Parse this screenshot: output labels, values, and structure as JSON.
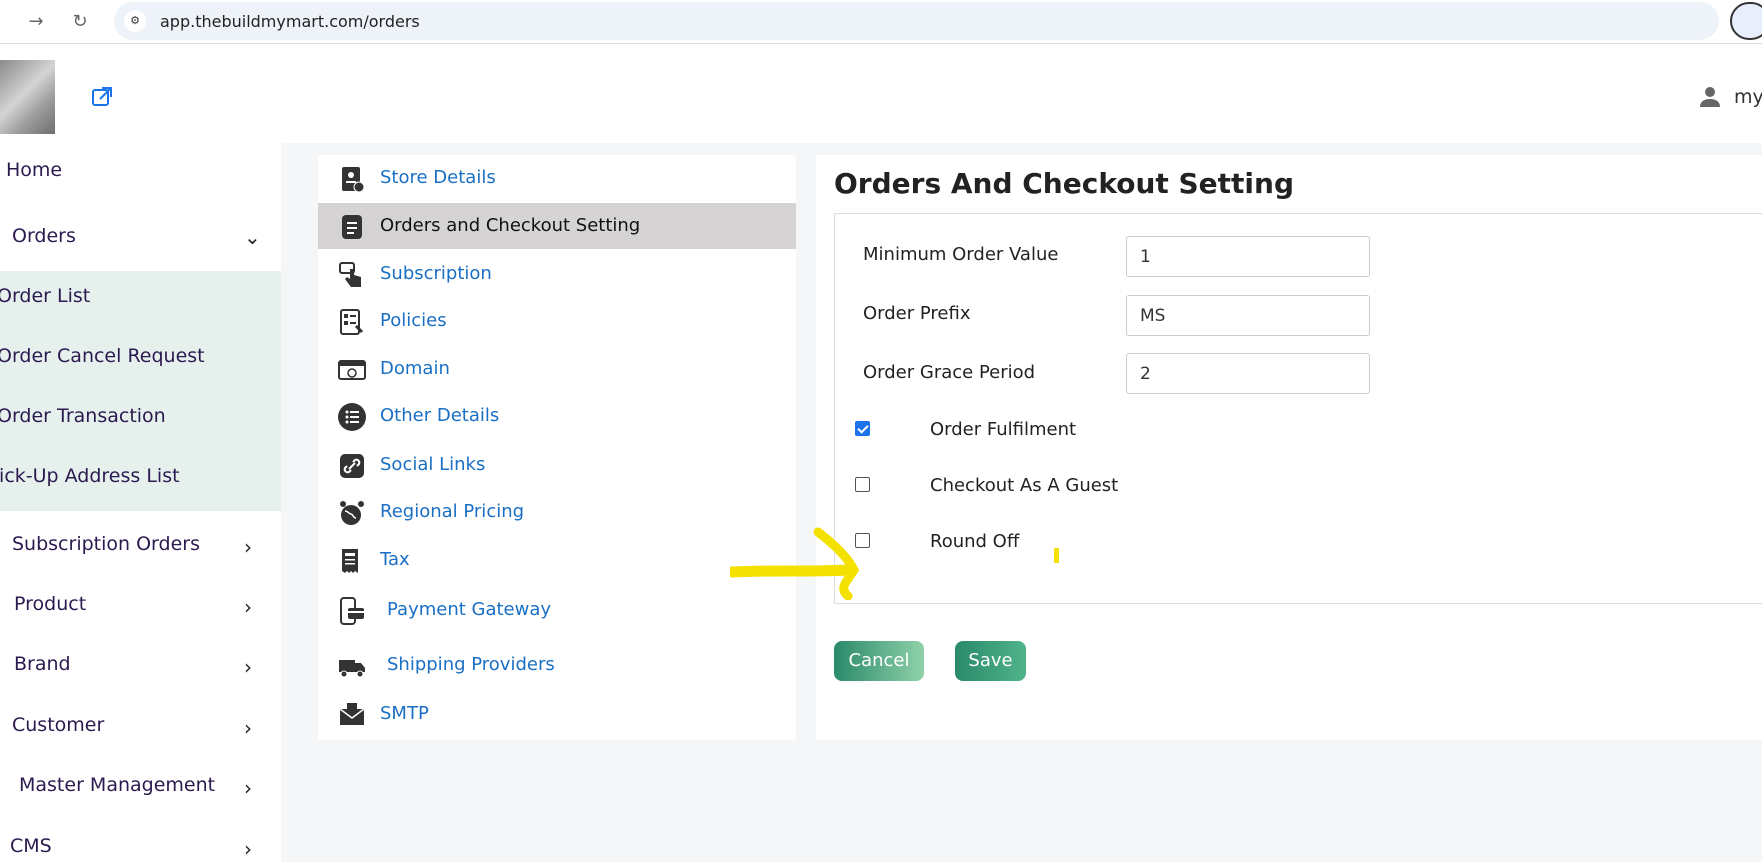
{
  "browser": {
    "url": "app.thebuildmymart.com/orders",
    "site_icon": "⚙"
  },
  "header": {
    "user_label": "my"
  },
  "sidebar": {
    "items": [
      {
        "label": "Home"
      },
      {
        "label": "Orders",
        "expanded": true
      },
      {
        "label": "Subscription Orders"
      },
      {
        "label": "Product"
      },
      {
        "label": "Brand"
      },
      {
        "label": "Customer"
      },
      {
        "label": "Master Management"
      },
      {
        "label": "CMS"
      }
    ],
    "orders_submenu": [
      {
        "label": "Order List"
      },
      {
        "label": "Order Cancel Request"
      },
      {
        "label": "Order Transaction"
      },
      {
        "label": "Pick-Up Address List"
      }
    ]
  },
  "settings_nav": {
    "items": [
      {
        "label": "Store Details",
        "icon": "store-details-icon"
      },
      {
        "label": "Orders and Checkout Setting",
        "icon": "document-icon",
        "active": true
      },
      {
        "label": "Subscription",
        "icon": "hand-pointer-icon"
      },
      {
        "label": "Policies",
        "icon": "policies-icon"
      },
      {
        "label": "Domain",
        "icon": "domain-icon"
      },
      {
        "label": "Other Details",
        "icon": "list-icon"
      },
      {
        "label": "Social Links",
        "icon": "link-icon"
      },
      {
        "label": "Regional Pricing",
        "icon": "globe-icon"
      },
      {
        "label": "Tax",
        "icon": "tax-receipt-icon"
      },
      {
        "label": "Payment Gateway",
        "icon": "payment-icon"
      },
      {
        "label": "Shipping Providers",
        "icon": "truck-icon"
      },
      {
        "label": "SMTP",
        "icon": "mail-icon"
      }
    ]
  },
  "main": {
    "title": "Orders And Checkout Setting",
    "fields": {
      "min_order": {
        "label": "Minimum Order Value",
        "value": "1"
      },
      "prefix": {
        "label": "Order Prefix",
        "value": "MS"
      },
      "grace": {
        "label": "Order Grace Period",
        "value": "2"
      }
    },
    "checkboxes": {
      "fulfilment": {
        "label": "Order Fulfilment",
        "checked": true
      },
      "guest": {
        "label": "Checkout As A Guest",
        "checked": false
      },
      "round_off": {
        "label": "Round Off",
        "checked": false
      }
    },
    "cancel_label": "Cancel",
    "save_label": "Save"
  },
  "colors": {
    "link": "#1a6fc4",
    "accent_green": "#2a8a6a",
    "annotation": "#f5e100",
    "submenu_bg": "#e6f1ee"
  }
}
